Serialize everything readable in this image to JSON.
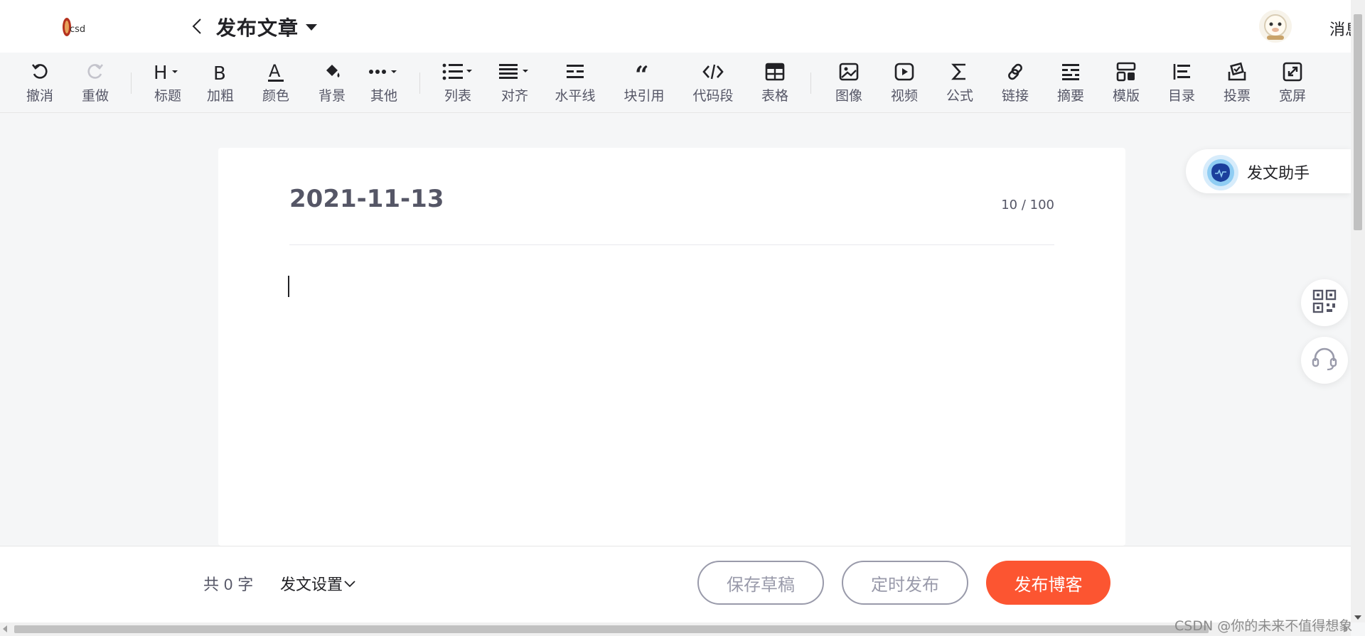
{
  "header": {
    "title": "发布文章",
    "message_label": "消息"
  },
  "toolbar": {
    "items": [
      {
        "label": "撤消",
        "icon": "undo-icon"
      },
      {
        "label": "重做",
        "icon": "redo-icon"
      },
      {
        "label": "标题",
        "icon": "heading-icon"
      },
      {
        "label": "加粗",
        "icon": "bold-icon"
      },
      {
        "label": "颜色",
        "icon": "text-color-icon"
      },
      {
        "label": "背景",
        "icon": "paint-bucket-icon"
      },
      {
        "label": "其他",
        "icon": "more-icon"
      },
      {
        "label": "列表",
        "icon": "list-icon"
      },
      {
        "label": "对齐",
        "icon": "align-icon"
      },
      {
        "label": "水平线",
        "icon": "horizontal-rule-icon"
      },
      {
        "label": "块引用",
        "icon": "blockquote-icon"
      },
      {
        "label": "代码段",
        "icon": "code-icon"
      },
      {
        "label": "表格",
        "icon": "table-icon"
      },
      {
        "label": "图像",
        "icon": "image-icon"
      },
      {
        "label": "视频",
        "icon": "video-icon"
      },
      {
        "label": "公式",
        "icon": "sigma-icon"
      },
      {
        "label": "链接",
        "icon": "link-icon"
      },
      {
        "label": "摘要",
        "icon": "summary-icon"
      },
      {
        "label": "模版",
        "icon": "template-icon"
      },
      {
        "label": "目录",
        "icon": "toc-icon"
      },
      {
        "label": "投票",
        "icon": "vote-icon"
      },
      {
        "label": "宽屏",
        "icon": "widescreen-icon"
      }
    ]
  },
  "editor": {
    "title": "2021-11-13",
    "title_count": "10 / 100"
  },
  "assistant": {
    "label": "发文助手"
  },
  "bottom": {
    "word_count_prefix": "共",
    "word_count_value": "0",
    "word_count_suffix": "字",
    "settings_label": "发文设置",
    "save_draft": "保存草稿",
    "schedule": "定时发布",
    "publish": "发布博客"
  },
  "watermark": "CSDN @你的未来不值得想象",
  "colors": {
    "primary": "#fc5531",
    "text": "#222226",
    "muted": "#555666",
    "outline": "#999aaa"
  }
}
